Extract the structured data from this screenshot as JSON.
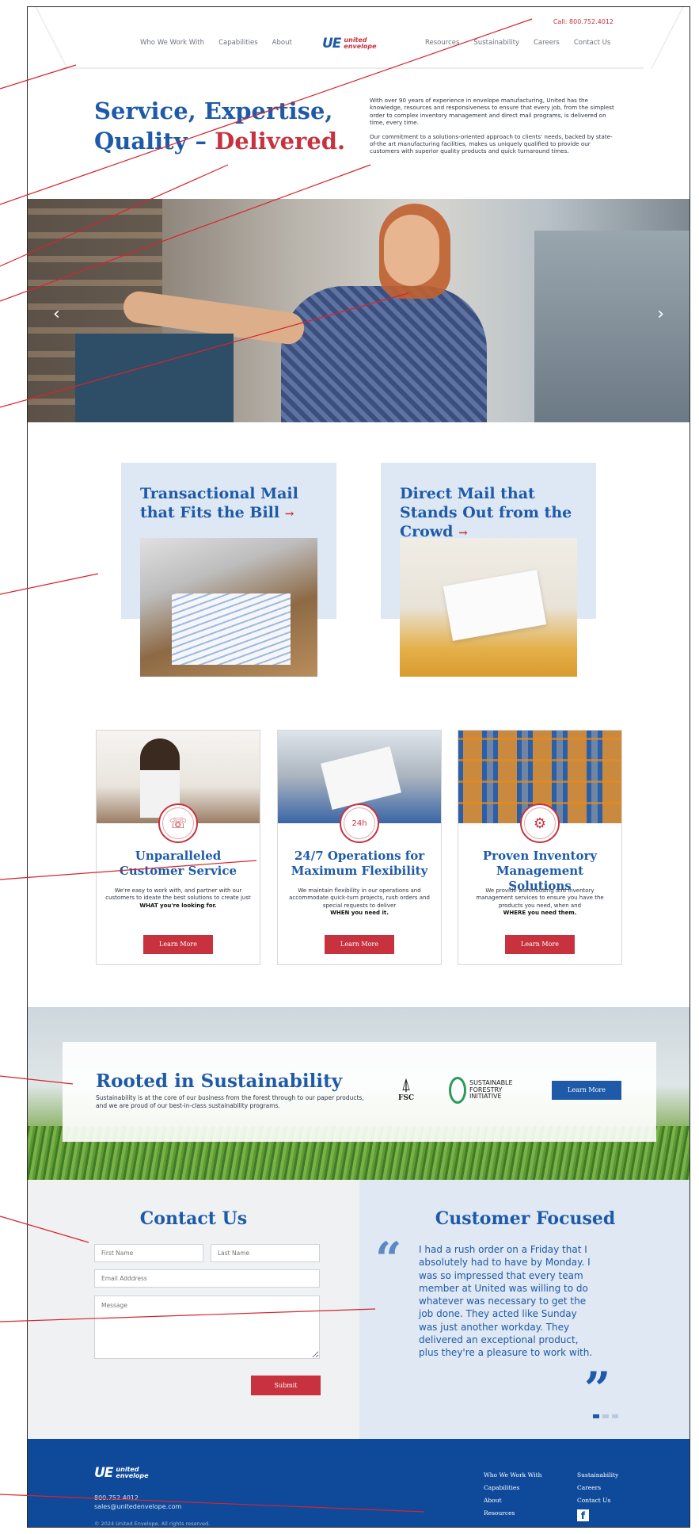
{
  "header": {
    "call": "Call: 800.752.4012",
    "nav_left": [
      "Who We Work With",
      "Capabilities",
      "About"
    ],
    "nav_right": [
      "Resources",
      "Sustainability",
      "Careers",
      "Contact Us"
    ],
    "logo_mark": "UE",
    "logo_line1": "united",
    "logo_line2": "envelope"
  },
  "hero": {
    "title_line1": "Service, Expertise,",
    "title_line2_a": "Quality – ",
    "title_line2_b": "Delivered.",
    "paragraph1": "With over 90 years of experience in envelope manufacturing, United has the knowledge, resources and responsiveness to ensure that every job, from the simplest order to complex inventory management and direct mail programs, is delivered on time, every time.",
    "paragraph2": "Our commitment to a solutions-oriented approach to clients' needs, backed by state-of-the art manufacturing facilities, makes us uniquely qualified to provide our customers with superior quality products and quick turnaround times.",
    "prev_icon": "‹",
    "next_icon": "›"
  },
  "features": [
    {
      "title": "Transactional Mail that Fits the Bill",
      "arrow": "→"
    },
    {
      "title": "Direct Mail that Stands Out from the Crowd",
      "arrow": "→"
    }
  ],
  "services": [
    {
      "icon": "phone-icon",
      "glyph": "☏",
      "title": "Unparalleled Customer Service",
      "desc": "We're easy to work with, and partner with our customers to ideate the best solutions to create just",
      "emph": "WHAT you're looking for.",
      "button": "Learn More"
    },
    {
      "icon": "clock-24h-icon",
      "glyph": "24h",
      "title": "24/7 Operations for Maximum Flexibility",
      "desc": "We maintain flexibility in our operations and accommodate quick-turn projects, rush orders and special requests to deliver",
      "emph": "WHEN you need it.",
      "button": "Learn More"
    },
    {
      "icon": "gear-icon",
      "glyph": "⚙",
      "title": "Proven Inventory Management Solutions",
      "desc": "We provide warehousing and inventory management services to ensure you have the products you need, when and",
      "emph": "WHERE you need them.",
      "button": "Learn More"
    }
  ],
  "sustainability": {
    "title": "Rooted in Sustainability",
    "copy": "Sustainability is at the core of our business from the forest through to our paper products, and we are proud of our best-in-class sustainability programs.",
    "fsc_label": "FSC",
    "sfi_line1": "SUSTAINABLE",
    "sfi_line2": "FORESTRY",
    "sfi_line3": "INITIATIVE",
    "button": "Learn More"
  },
  "contact": {
    "title": "Contact Us",
    "first_placeholder": "First Name",
    "last_placeholder": "Last Name",
    "email_placeholder": "Email Adddress",
    "message_placeholder": "Message",
    "submit": "Submit"
  },
  "testimonial": {
    "title": "Customer Focused",
    "open_quote": "“",
    "close_quote": "”",
    "quote": "I had a rush order on a Friday that I absolutely had to have by Monday. I was so impressed that every team member at United was willing to do whatever was necessary to get the job done. They acted like Sunday was just another workday. They delivered an exceptional product, plus they're a pleasure to work with."
  },
  "footer": {
    "logo_mark": "UE",
    "logo_line1": "united",
    "logo_line2": "envelope",
    "phone": "800.752.4012",
    "email": "sales@unitedenvelope.com",
    "copyright": "© 2024 United Envelope. All rights reserved.",
    "col1": [
      "Who We Work With",
      "Capabilities",
      "About",
      "Resources"
    ],
    "col2": [
      "Sustainability",
      "Careers",
      "Contact Us"
    ],
    "facebook": "f"
  },
  "colors": {
    "brand_blue": "#1e5aa8",
    "brand_red": "#c8323f",
    "footer_blue": "#0f4a9a"
  }
}
